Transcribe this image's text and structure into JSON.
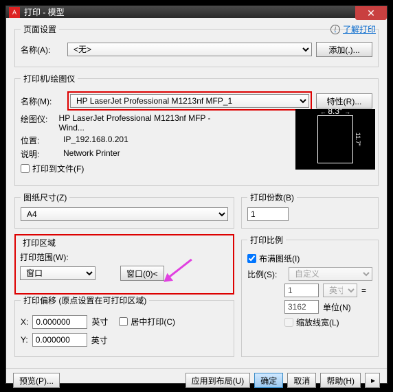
{
  "window": {
    "title": "打印 - 模型"
  },
  "help": {
    "link_text": "了解打印"
  },
  "page_setup": {
    "legend": "页面设置",
    "name_label": "名称(A):",
    "name_value": "<无>",
    "add_button": "添加(.)..."
  },
  "printer": {
    "legend": "打印机/绘图仪",
    "name_label": "名称(M):",
    "name_value": "HP LaserJet Professional M1213nf MFP_1",
    "properties_button": "特性(R)...",
    "plotter_label": "绘图仪:",
    "plotter_value": "HP LaserJet Professional M1213nf MFP - Wind...",
    "location_label": "位置:",
    "location_value": "IP_192.168.0.201",
    "description_label": "说明:",
    "description_value": "Network Printer",
    "print_to_file_label": "打印到文件(F)",
    "preview_width": "8.3''",
    "preview_height": "11.7''"
  },
  "paper": {
    "legend": "图纸尺寸(Z)",
    "value": "A4"
  },
  "copies": {
    "legend": "打印份数(B)",
    "value": "1"
  },
  "area": {
    "legend": "打印区域",
    "range_label": "打印范围(W):",
    "range_value": "窗口",
    "window_button": "窗口(0)<"
  },
  "offset": {
    "legend": "打印偏移 (原点设置在可打印区域)",
    "x_label": "X:",
    "x_value": "0.000000",
    "x_unit": "英寸",
    "y_label": "Y:",
    "y_value": "0.000000",
    "y_unit": "英寸",
    "center_label": "居中打印(C)"
  },
  "scale": {
    "legend": "打印比例",
    "fit_label": "布满图纸(I)",
    "scale_label": "比例(S):",
    "scale_value": "自定义",
    "num1_value": "1",
    "unit1_value": "英寸",
    "equals": "=",
    "num2_value": "3162",
    "unit2_label": "单位(N)",
    "lineweight_label": "缩放线宽(L)"
  },
  "buttons": {
    "preview": "预览(P)...",
    "apply": "应用到布局(U)",
    "ok": "确定",
    "cancel": "取消",
    "help": "帮助(H)"
  }
}
